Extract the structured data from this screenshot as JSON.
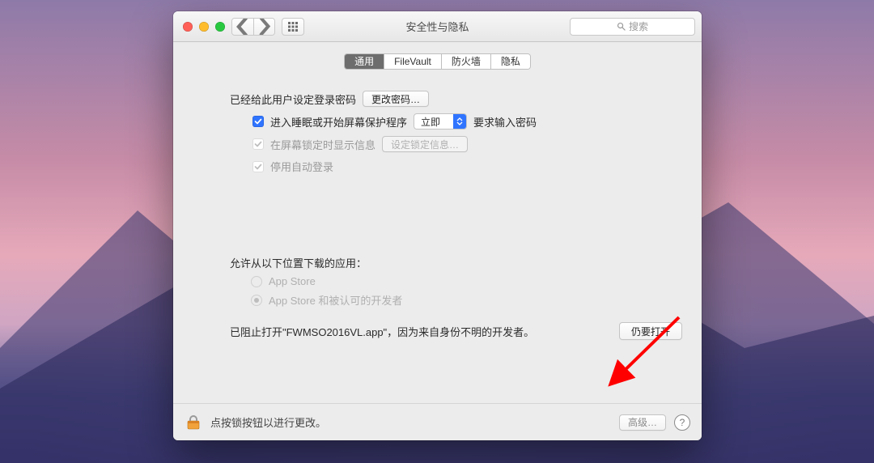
{
  "colors": {
    "accent": "#2f74ff",
    "annotation": "#ff0000"
  },
  "window": {
    "title": "安全性与隐私"
  },
  "toolbar": {
    "search_placeholder": "搜索"
  },
  "tabs": [
    {
      "label": "通用",
      "active": true
    },
    {
      "label": "FileVault",
      "active": false
    },
    {
      "label": "防火墙",
      "active": false
    },
    {
      "label": "隐私",
      "active": false
    }
  ],
  "general": {
    "password_set_prefix": "已经给此用户设定登录密码",
    "change_password_btn": "更改密码…",
    "require_password_label": "进入睡眠或开始屏幕保护程序",
    "require_password_select": "立即",
    "require_password_suffix": "要求输入密码",
    "show_msg_label": "在屏幕锁定时显示信息",
    "set_msg_btn": "设定锁定信息…",
    "disable_autologin_label": "停用自动登录"
  },
  "allow": {
    "heading": "允许从以下位置下载的应用：",
    "options": [
      {
        "label": "App Store",
        "selected": false
      },
      {
        "label": "App Store 和被认可的开发者",
        "selected": true
      }
    ]
  },
  "blocked": {
    "message": "已阻止打开\"FWMSO2016VL.app\"，因为来自身份不明的开发者。",
    "open_anyway_btn": "仍要打开"
  },
  "footer": {
    "lock_hint": "点按锁按钮以进行更改。",
    "advanced_btn": "高级…"
  }
}
